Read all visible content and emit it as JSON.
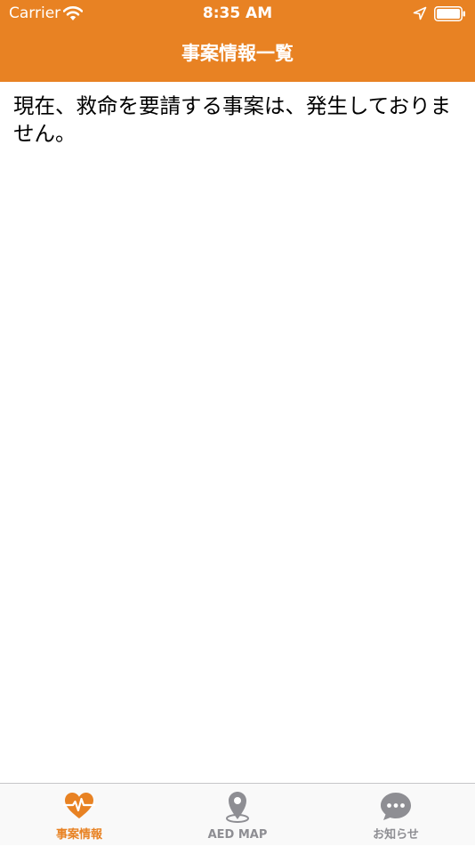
{
  "status_bar": {
    "carrier": "Carrier",
    "time": "8:35 AM"
  },
  "nav": {
    "title": "事案情報一覧"
  },
  "content": {
    "message": "現在、救命を要請する事案は、発生しておりません。"
  },
  "tabs": [
    {
      "label": "事案情報",
      "icon": "heartbeat-icon",
      "selected": true
    },
    {
      "label": "AED MAP",
      "icon": "map-pin-icon",
      "selected": false
    },
    {
      "label": "お知らせ",
      "icon": "chat-bubble-icon",
      "selected": false
    }
  ],
  "colors": {
    "accent": "#E88223",
    "tab_inactive": "#8E8E93",
    "background": "#FFFFFF",
    "tab_bar": "#F9F9F9"
  }
}
